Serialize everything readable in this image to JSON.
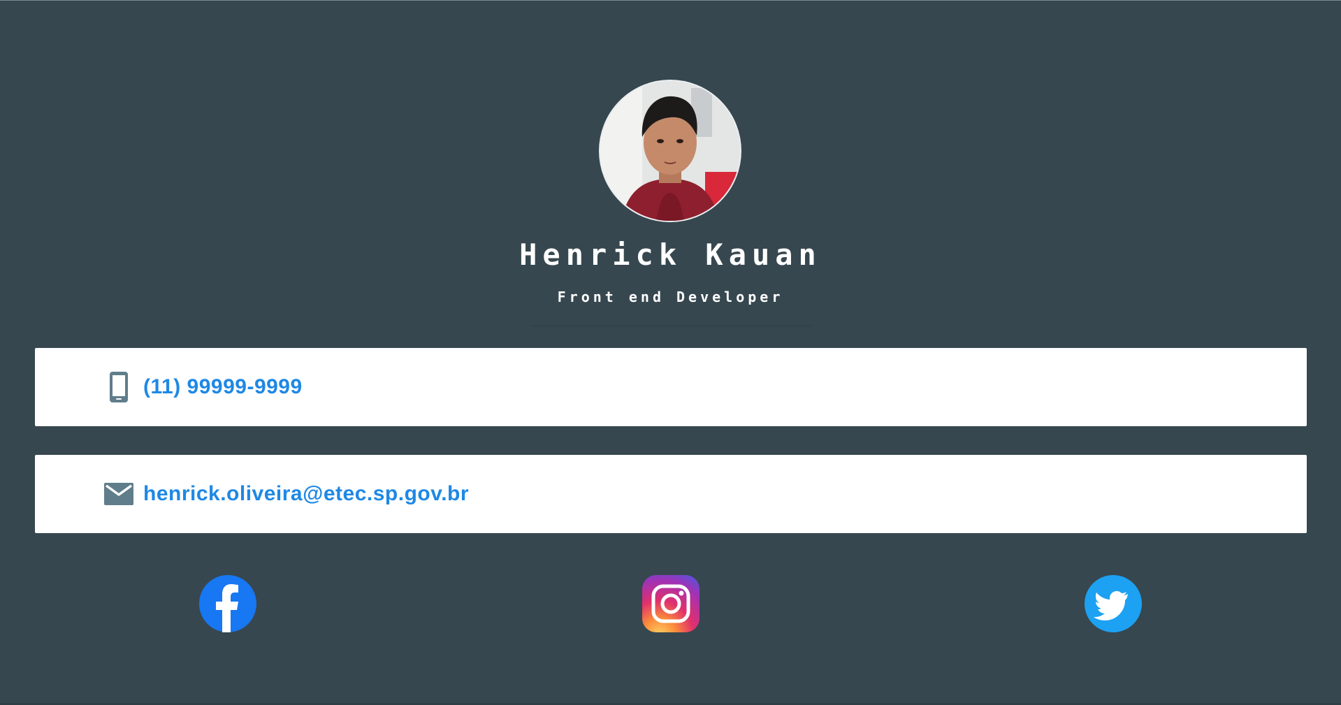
{
  "profile": {
    "name": "Henrick Kauan",
    "role": "Front end Developer",
    "avatar_icon": "profile-photo"
  },
  "contacts": [
    {
      "icon": "smartphone-icon",
      "text": "(11) 99999-9999"
    },
    {
      "icon": "mail-icon",
      "text": "henrick.oliveira@etec.sp.gov.br"
    }
  ],
  "social": [
    {
      "icon": "facebook-icon",
      "color": "#1877f2"
    },
    {
      "icon": "instagram-icon",
      "color": "#e1306c"
    },
    {
      "icon": "twitter-icon",
      "color": "#1da1f2"
    }
  ],
  "colors": {
    "background": "#37474f",
    "card": "#ffffff",
    "link": "#1e88e5",
    "icon": "#607d8b"
  }
}
